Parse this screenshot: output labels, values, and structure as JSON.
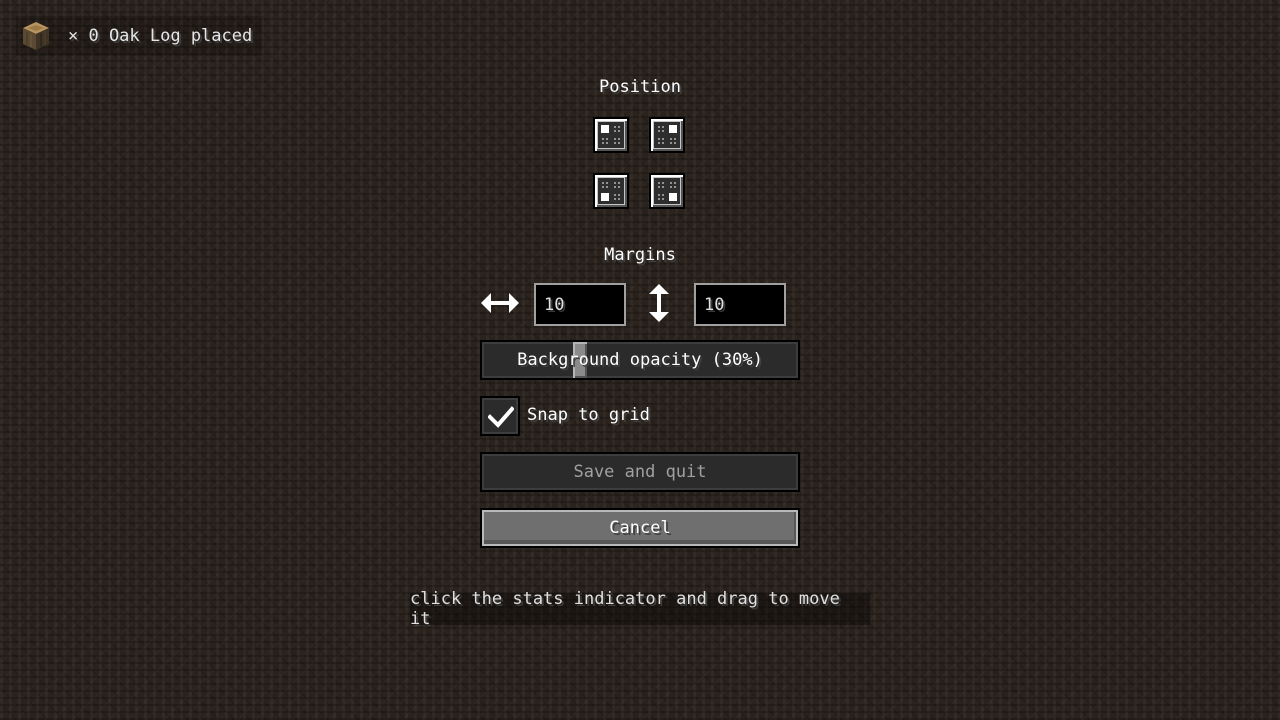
{
  "hud": {
    "icon": "oak-log-icon",
    "text": "× 0 Oak Log placed"
  },
  "position": {
    "label": "Position",
    "options": [
      {
        "name": "top-left",
        "icon": "corner-top-left-icon"
      },
      {
        "name": "top-right",
        "icon": "corner-top-right-icon"
      },
      {
        "name": "bottom-left",
        "icon": "corner-bottom-left-icon"
      },
      {
        "name": "bottom-right",
        "icon": "corner-bottom-right-icon"
      }
    ]
  },
  "margins": {
    "label": "Margins",
    "horizontal_icon": "horizontal-arrow-icon",
    "vertical_icon": "vertical-arrow-icon",
    "horizontal_value": "10",
    "vertical_value": "10"
  },
  "opacity": {
    "label": "Background opacity (30%)",
    "value_percent": 30
  },
  "snap": {
    "label": "Snap to grid",
    "checked": true
  },
  "buttons": {
    "save_label": "Save and quit",
    "cancel_label": "Cancel"
  },
  "hint": "click the stats indicator and drag to move it",
  "colors": {
    "disabled_text": "#a0a0a0",
    "text": "#ffffff"
  }
}
